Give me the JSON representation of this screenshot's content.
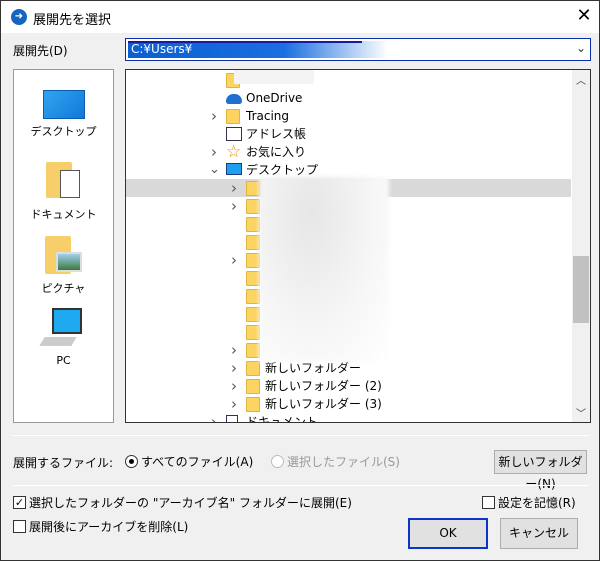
{
  "window": {
    "title": "展開先を選択",
    "close_icon": "close-icon"
  },
  "destination": {
    "label": "展開先(D)",
    "value": "C:¥Users¥"
  },
  "places": [
    {
      "label": "デスクトップ",
      "icon": "desktop-icon"
    },
    {
      "label": "ドキュメント",
      "icon": "documents-icon"
    },
    {
      "label": "ピクチャ",
      "icon": "pictures-icon"
    },
    {
      "label": "PC",
      "icon": "pc-icon"
    }
  ],
  "tree": {
    "items": [
      {
        "label": "",
        "expander": "none",
        "icon": "folder"
      },
      {
        "label": "OneDrive",
        "expander": "none",
        "icon": "onedrive"
      },
      {
        "label": "Tracing",
        "expander": "collapsed",
        "icon": "folder"
      },
      {
        "label": "アドレス帳",
        "expander": "none",
        "icon": "contacts"
      },
      {
        "label": "お気に入り",
        "expander": "collapsed",
        "icon": "star"
      },
      {
        "label": "デスクトップ",
        "expander": "expanded",
        "icon": "desktop"
      },
      {
        "label": "",
        "expander": "collapsed",
        "icon": "folder",
        "selected": true
      },
      {
        "label": "",
        "expander": "collapsed",
        "icon": "folder"
      },
      {
        "label": "",
        "expander": "none",
        "icon": "folder"
      },
      {
        "label": "",
        "expander": "none",
        "icon": "folder"
      },
      {
        "label": "",
        "expander": "collapsed",
        "icon": "folder"
      },
      {
        "label": "",
        "expander": "none",
        "icon": "folder"
      },
      {
        "label": "",
        "expander": "none",
        "icon": "folder"
      },
      {
        "label": "",
        "expander": "none",
        "icon": "folder"
      },
      {
        "label": "",
        "expander": "none",
        "icon": "folder"
      },
      {
        "label": "",
        "expander": "collapsed",
        "icon": "folder"
      },
      {
        "label": "新しいフォルダー",
        "expander": "collapsed",
        "icon": "folder"
      },
      {
        "label": "新しいフォルダー (2)",
        "expander": "collapsed",
        "icon": "folder"
      },
      {
        "label": "新しいフォルダー (3)",
        "expander": "collapsed",
        "icon": "folder"
      },
      {
        "label": "ドキュメント",
        "expander": "collapsed",
        "icon": "documents"
      }
    ]
  },
  "files": {
    "label": "展開するファイル:",
    "all": "すべてのファイル(A)",
    "selected": "選択したファイル(S)",
    "all_checked": true,
    "new_folder": "新しいフォルダー(N)"
  },
  "options": {
    "extract_to_archive_folder": {
      "label": "選択したフォルダーの \"アーカイブ名\" フォルダーに展開(E)",
      "checked": true
    },
    "delete_after": {
      "label": "展開後にアーカイブを削除(L)",
      "checked": false
    },
    "remember": {
      "label": "設定を記憶(R)",
      "checked": false
    }
  },
  "buttons": {
    "ok": "OK",
    "cancel": "キャンセル"
  }
}
